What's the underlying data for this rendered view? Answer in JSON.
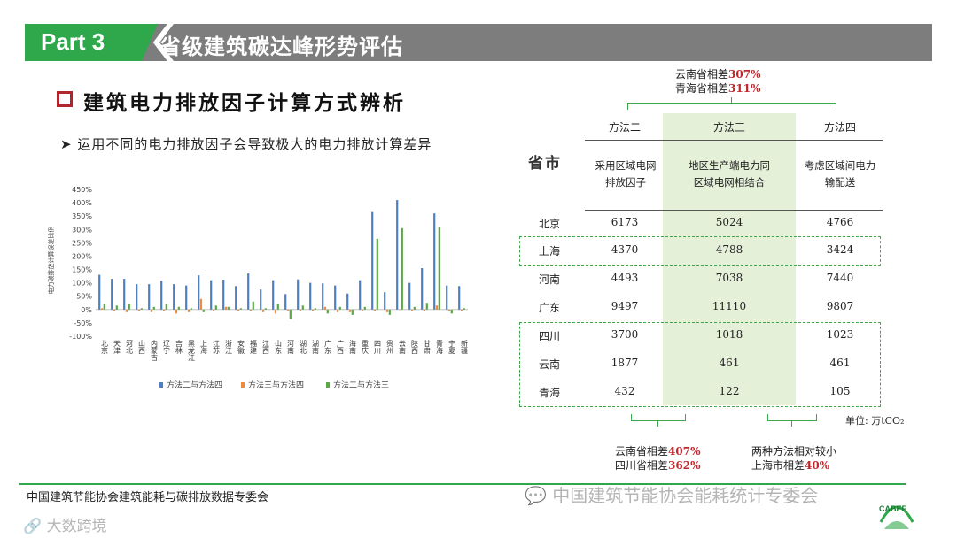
{
  "header": {
    "part": "Part 3",
    "title": "省级建筑碳达峰形势评估"
  },
  "section_title": "建筑电力排放因子计算方式辨析",
  "bullet": "运用不同的电力排放因子会导致极大的电力排放计算差异",
  "chart_data": {
    "type": "bar",
    "ylabel": "电力碳排放计算误差比例",
    "ylim": [
      -100,
      450
    ],
    "yticks": [
      "450%",
      "400%",
      "350%",
      "300%",
      "250%",
      "200%",
      "150%",
      "100%",
      "50%",
      "0%",
      "-50%",
      "-100%"
    ],
    "categories": [
      "北京",
      "天津",
      "河北",
      "山西",
      "内蒙古",
      "辽宁",
      "吉林",
      "黑龙江",
      "上海",
      "江苏",
      "浙江",
      "安徽",
      "福建",
      "江西",
      "山东",
      "河南",
      "湖北",
      "湖南",
      "广东",
      "广西",
      "海南",
      "重庆",
      "四川",
      "贵州",
      "云南",
      "陕西",
      "甘肃",
      "青海",
      "宁夏",
      "新疆"
    ],
    "series": [
      {
        "name": "方法二与方法四",
        "color": "#4e7fbf",
        "values": [
          130,
          115,
          115,
          95,
          95,
          108,
          95,
          90,
          128,
          110,
          112,
          88,
          135,
          75,
          110,
          58,
          113,
          100,
          98,
          90,
          60,
          110,
          365,
          65,
          410,
          100,
          155,
          360,
          90,
          88
        ]
      },
      {
        "name": "方法三与方法四",
        "color": "#ed8c3c",
        "values": [
          5,
          -5,
          -10,
          -5,
          -10,
          -5,
          -15,
          -10,
          40,
          -5,
          10,
          -5,
          -5,
          -10,
          -15,
          -5,
          -5,
          -5,
          10,
          -10,
          -10,
          -5,
          -5,
          -10,
          0,
          -5,
          -5,
          15,
          -5,
          -5
        ]
      },
      {
        "name": "方法二与方法三",
        "color": "#5aa846",
        "values": [
          20,
          15,
          20,
          5,
          10,
          20,
          10,
          5,
          -10,
          15,
          10,
          5,
          30,
          5,
          20,
          -35,
          15,
          5,
          -15,
          10,
          -20,
          10,
          265,
          -20,
          305,
          10,
          25,
          310,
          -15,
          5
        ]
      }
    ]
  },
  "table": {
    "province_header": "省市",
    "columns": [
      {
        "name": "方法二",
        "desc": [
          "采用区域电网",
          "排放因子"
        ]
      },
      {
        "name": "方法三",
        "desc": [
          "地区生产端电力同",
          "区域电网相结合"
        ]
      },
      {
        "name": "方法四",
        "desc": [
          "考虑区域间电力",
          "输配送"
        ]
      }
    ],
    "rows": [
      {
        "province": "北京",
        "values": [
          "6173",
          "5024",
          "4766"
        ]
      },
      {
        "province": "上海",
        "values": [
          "4370",
          "4788",
          "3424"
        ]
      },
      {
        "province": "河南",
        "values": [
          "4493",
          "7038",
          "7440"
        ]
      },
      {
        "province": "广东",
        "values": [
          "9497",
          "11110",
          "9807"
        ]
      },
      {
        "province": "四川",
        "values": [
          "3700",
          "1018",
          "1023"
        ]
      },
      {
        "province": "云南",
        "values": [
          "1877",
          "461",
          "461"
        ]
      },
      {
        "province": "青海",
        "values": [
          "432",
          "122",
          "105"
        ]
      }
    ],
    "unit": "单位: 万tCO₂"
  },
  "notes": {
    "top": [
      {
        "text": "云南省相差",
        "value": "307%"
      },
      {
        "text": "青海省相差",
        "value": "311%"
      }
    ],
    "bottom_left": [
      {
        "text": "云南省相差",
        "value": "407%"
      },
      {
        "text": "四川省相差",
        "value": "362%"
      }
    ],
    "bottom_right_1": "两种方法相对较小",
    "bottom_right_2": {
      "text": "上海市相差",
      "value": "40%"
    }
  },
  "footer": {
    "org": "中国建筑节能协会建筑能耗与碳排放数据专委会",
    "watermark": "中国建筑节能协会能耗统计专委会",
    "watermark2": "大数跨境",
    "logo": "CABEE"
  }
}
